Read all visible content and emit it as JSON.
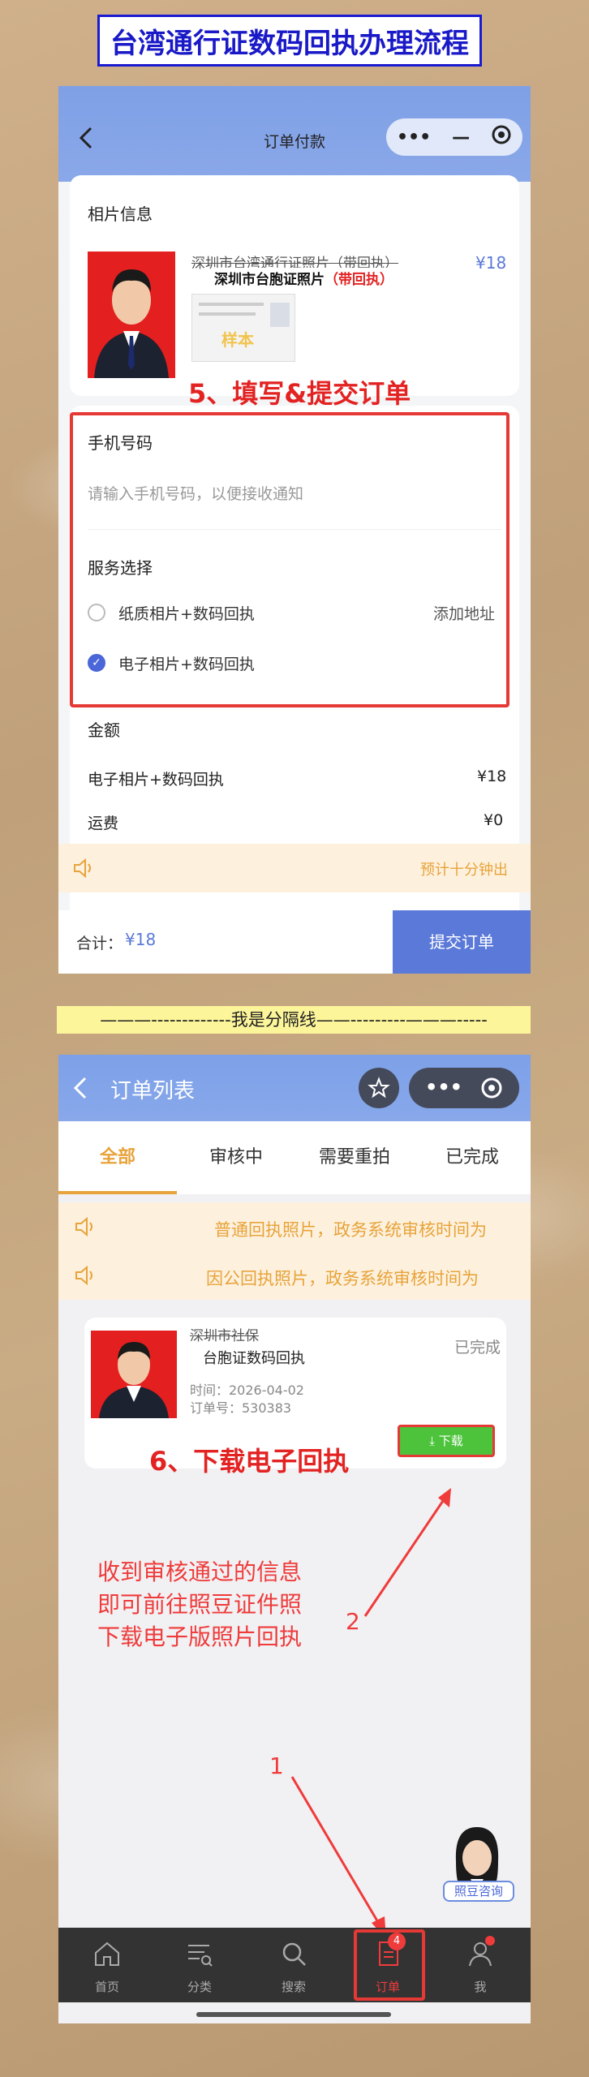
{
  "banner_title": "台湾通行证数码回执办理流程",
  "screen1": {
    "nav_title": "订单付款",
    "capsule_more": "•••",
    "capsule_min": "—",
    "photo_info_label": "相片信息",
    "product_name_strike": "深圳市台湾通行证照片（带回执）",
    "product_name": "深圳市台胞证照片",
    "product_suffix": "（带回执）",
    "product_price": "¥18",
    "sample_stamp": "样本",
    "step5_caption": "5、填写&提交订单",
    "phone_label": "手机号码",
    "phone_placeholder": "请输入手机号码，以便接收通知",
    "service_label": "服务选择",
    "option_paper": "纸质相片+数码回执",
    "add_address": "添加地址",
    "option_digital": "电子相片+数码回执",
    "amount_label": "金额",
    "amount_item": "电子相片+数码回执",
    "amount_item_price": "¥18",
    "shipping_label": "运费",
    "shipping_price": "¥0",
    "eta_notice": "预计十分钟出",
    "total_label": "合计：",
    "total_value": "¥18",
    "submit_button": "提交订单"
  },
  "separator_text": "———-------------我是分隔线——---------———-----",
  "screen2": {
    "nav_title": "订单列表",
    "tabs": [
      "全部",
      "审核中",
      "需要重拍",
      "已完成"
    ],
    "notice1": "普通回执照片，政务系统审核时间为",
    "notice2": "因公回执照片，政务系统审核时间为",
    "order_name_strike": "深圳市社保",
    "order_name": "台胞证数码回执",
    "order_status": "已完成",
    "order_time": "时间：2026-04-02",
    "order_no": "订单号：530383",
    "download_button": "⤓ 下载",
    "step6_caption": "6、下载电子回执",
    "hint_line1": "收到审核通过的信息",
    "hint_line2": "即可前往照豆证件照",
    "hint_line3": "下载电子版照片回执",
    "marker_1": "1",
    "marker_2": "2",
    "consult_label": "照豆咨询",
    "tabbar": [
      {
        "label": "首页",
        "icon": "home-icon"
      },
      {
        "label": "分类",
        "icon": "category-icon"
      },
      {
        "label": "搜索",
        "icon": "search-icon"
      },
      {
        "label": "订单",
        "icon": "order-icon"
      },
      {
        "label": "我",
        "icon": "profile-icon"
      }
    ],
    "order_badge": "4"
  },
  "colors": {
    "nav_blue": "#7fa0e6",
    "submit_blue": "#5b79d8",
    "highlight_red": "#e53935",
    "notice_orange": "#e8a33a",
    "download_green": "#4cc33b"
  }
}
